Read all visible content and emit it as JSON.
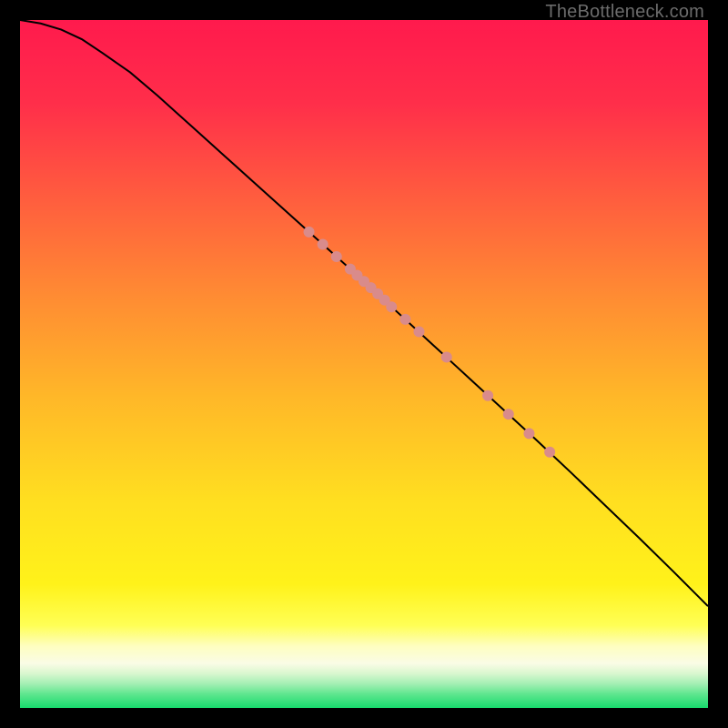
{
  "watermark": "TheBottleneck.com",
  "chart_data": {
    "type": "line",
    "title": "",
    "xlabel": "",
    "ylabel": "",
    "xlim": [
      0,
      100
    ],
    "ylim": [
      0,
      100
    ],
    "background_gradient_stops": [
      {
        "offset": 0.0,
        "color": "#ff1a4d"
      },
      {
        "offset": 0.12,
        "color": "#ff2e4a"
      },
      {
        "offset": 0.25,
        "color": "#ff5a3f"
      },
      {
        "offset": 0.4,
        "color": "#ff8b33"
      },
      {
        "offset": 0.55,
        "color": "#ffb828"
      },
      {
        "offset": 0.7,
        "color": "#ffdf20"
      },
      {
        "offset": 0.82,
        "color": "#fff21a"
      },
      {
        "offset": 0.88,
        "color": "#ffff55"
      },
      {
        "offset": 0.91,
        "color": "#fefec0"
      },
      {
        "offset": 0.935,
        "color": "#fafce6"
      },
      {
        "offset": 0.95,
        "color": "#d9f7cf"
      },
      {
        "offset": 0.965,
        "color": "#a3efb3"
      },
      {
        "offset": 0.98,
        "color": "#5ee68e"
      },
      {
        "offset": 1.0,
        "color": "#17db6d"
      }
    ],
    "series": [
      {
        "name": "curve",
        "type": "line",
        "color": "#000000",
        "x": [
          0,
          3,
          6,
          9,
          12,
          16,
          20,
          25,
          30,
          35,
          40,
          45,
          50,
          55,
          60,
          65,
          70,
          75,
          80,
          85,
          90,
          95,
          100
        ],
        "y": [
          100,
          99.5,
          98.6,
          97.2,
          95.2,
          92.4,
          89.0,
          84.5,
          80.0,
          75.5,
          71.0,
          66.5,
          62.0,
          57.4,
          52.8,
          48.2,
          43.6,
          39.0,
          34.3,
          29.5,
          24.7,
          19.8,
          14.8
        ]
      },
      {
        "name": "highlight-points",
        "type": "scatter",
        "color": "#d98b8b",
        "x": [
          42,
          44,
          46,
          48,
          49,
          50,
          51,
          52,
          53,
          54,
          56,
          58,
          62,
          68,
          71,
          74,
          77
        ],
        "y": [
          69.2,
          67.4,
          65.6,
          63.8,
          62.9,
          62.0,
          61.1,
          60.2,
          59.3,
          58.3,
          56.5,
          54.7,
          51.0,
          45.4,
          42.7,
          39.9,
          37.2
        ],
        "radius": 6
      }
    ]
  }
}
